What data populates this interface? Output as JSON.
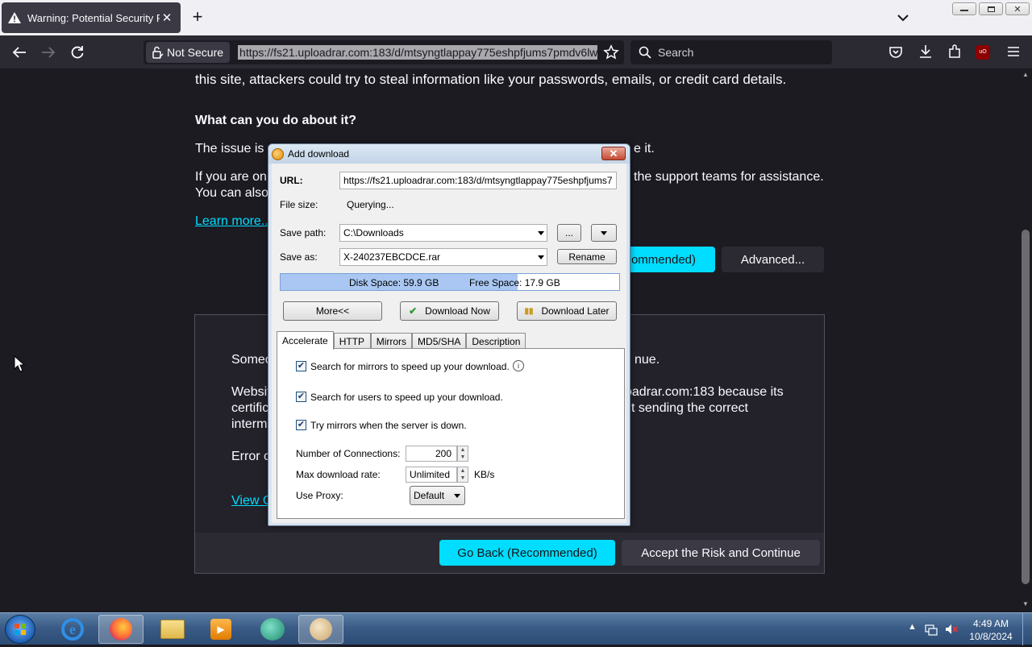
{
  "browser": {
    "tab_title": "Warning: Potential Security Risk",
    "new_tab": "+",
    "not_secure": "Not Secure",
    "url": "https://fs21.uploadrar.com:183/d/mtsyngtlappay775eshpfjums7pmdv6lw",
    "search_placeholder": "Search"
  },
  "page": {
    "line_top": "this site, attackers could try to steal information like your passwords, emails, or credit card details.",
    "heading": "What can you do about it?",
    "issue_start": "The issue is m",
    "issue_end": "e it.",
    "ifyou_start": "If you are on a",
    "ifyou_end": "the support teams for assistance.",
    "canalso": "You can also r",
    "learn_more": "Learn more...",
    "go_back_top_partial": "ommended)",
    "advanced": "Advanced...",
    "adv_someone": "Someo",
    "adv_someone_end": "nue.",
    "adv_website": "Websit",
    "adv_website_end": "oadrar.com:183 because its",
    "adv_certific": "certific",
    "adv_certific_end": "t sending the correct",
    "adv_interm": "interm",
    "adv_error": "Error c",
    "adv_view": "View C",
    "go_back": "Go Back (Recommended)",
    "accept": "Accept the Risk and Continue"
  },
  "dialog": {
    "title": "Add download",
    "close": "✕",
    "url_label": "URL:",
    "url_value": "https://fs21.uploadrar.com:183/d/mtsyngtlappay775eshpfjums7",
    "filesize_label": "File size:",
    "filesize_value": "Querying...",
    "savepath_label": "Save path:",
    "savepath_value": "C:\\Downloads",
    "browse_btn": "...",
    "saveas_label": "Save as:",
    "saveas_value": "X-240237EBCDCE.rar",
    "rename_btn": "Rename",
    "disk_space": "Disk Space: 59.9 GB",
    "free_space": "Free Space: 17.9 GB",
    "disk_used_fraction": 0.7,
    "more_btn": "More<<",
    "download_now": "Download Now",
    "download_later": "Download Later",
    "tabs": [
      "Accelerate",
      "HTTP",
      "Mirrors",
      "MD5/SHA",
      "Description"
    ],
    "opt_mirrors": "Search for mirrors to speed up your download.",
    "opt_users": "Search for users to speed up your download.",
    "opt_trymirrors": "Try mirrors when the server is down.",
    "connections_label": "Number of Connections:",
    "connections_value": "200",
    "maxrate_label": "Max download rate:",
    "maxrate_value": "Unlimited",
    "maxrate_unit": "KB/s",
    "proxy_label": "Use Proxy:",
    "proxy_value": "Default"
  },
  "taskbar": {
    "time": "4:49 AM",
    "date": "10/8/2024"
  }
}
